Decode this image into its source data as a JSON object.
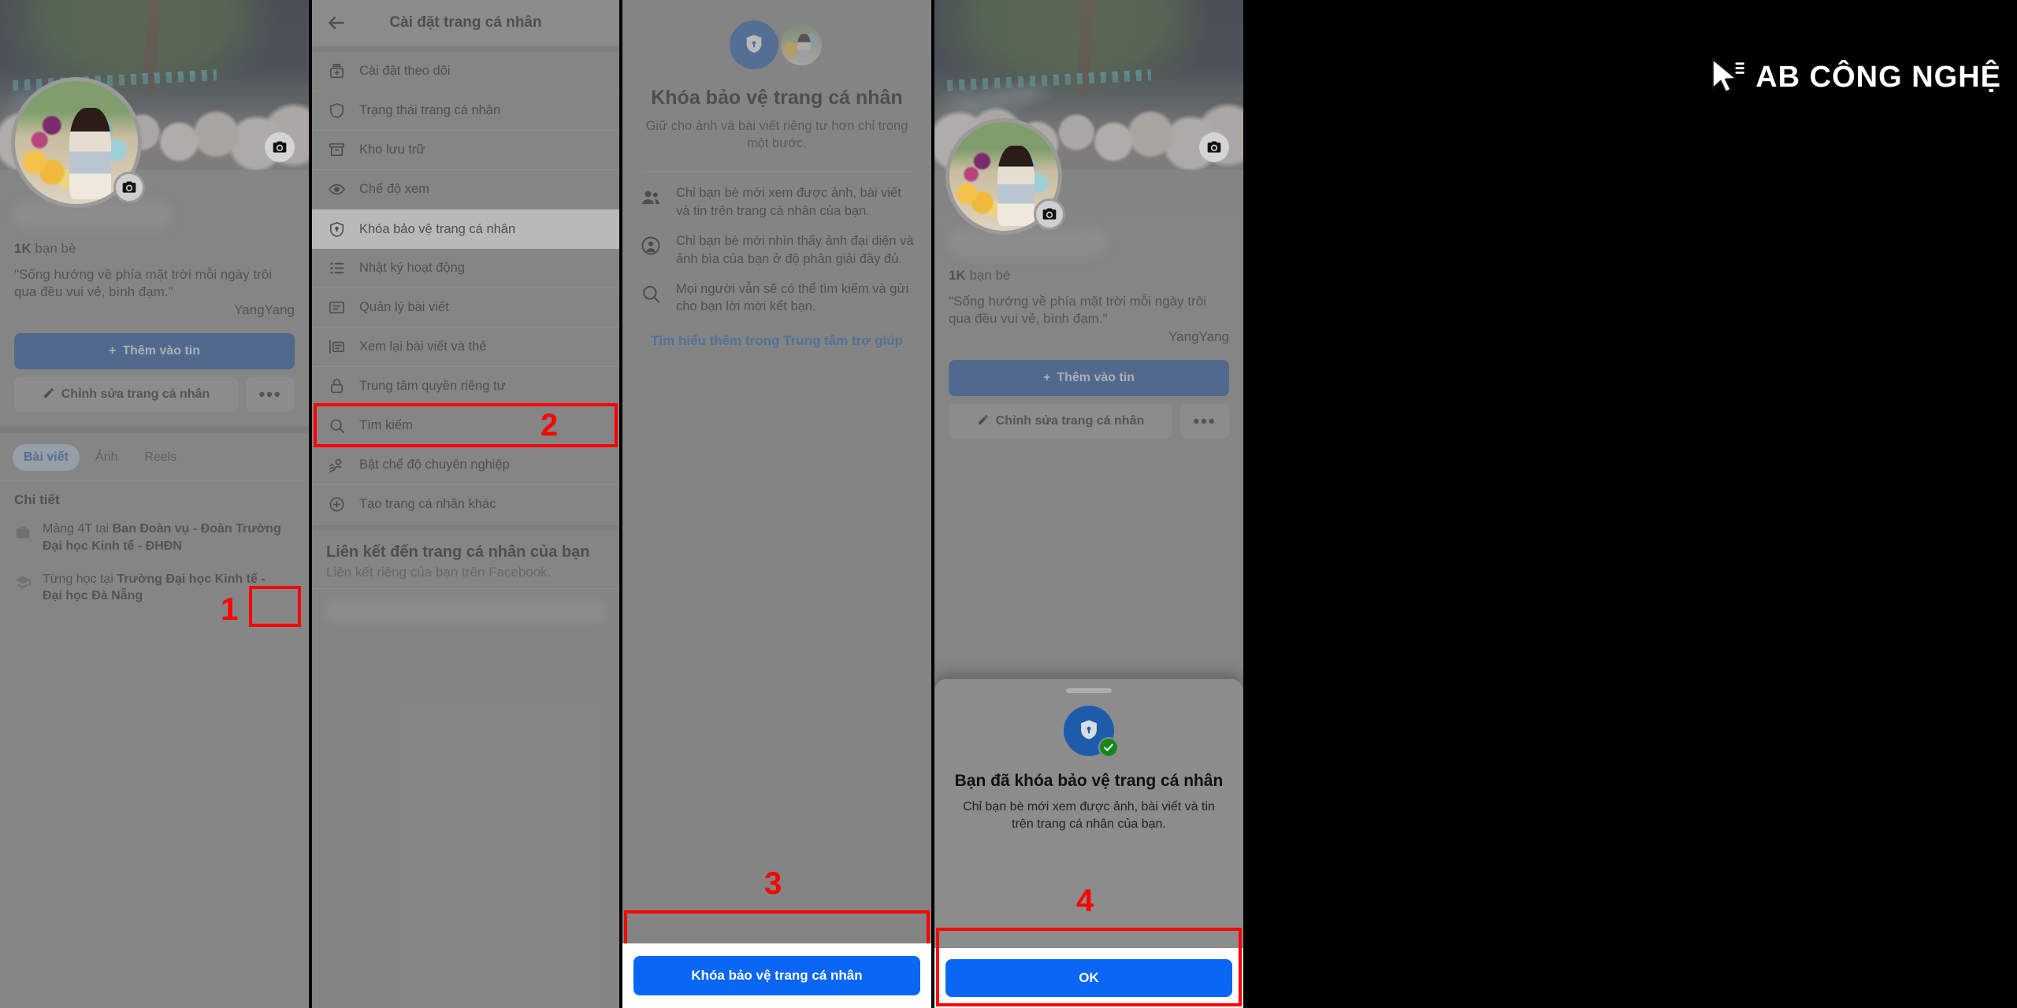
{
  "watermark": {
    "text": "AB CÔNG NGHỆ",
    "cursor_icon": "mouse-cursor-icon"
  },
  "annotations": {
    "step1": "1",
    "step2": "2",
    "step3": "3",
    "step4": "4"
  },
  "panel1": {
    "name_redacted": "",
    "friends_count": "1K",
    "friends_label": "bạn bè",
    "bio_line1": "\"Sống hướng về phía mặt trời mỗi ngày trôi",
    "bio_line2": "qua đều vui vẻ, bình đạm.\"",
    "bio_signature": "YangYang",
    "add_story_button": "Thêm vào tin",
    "add_story_icon": "plus-icon",
    "edit_profile_button": "Chỉnh sửa trang cá nhân",
    "edit_profile_icon": "pencil-icon",
    "more_button": "•••",
    "cover_camera_icon": "camera-icon",
    "avatar_camera_icon": "camera-icon",
    "tabs": [
      {
        "label": "Bài viết",
        "active": true
      },
      {
        "label": "Ảnh",
        "active": false
      },
      {
        "label": "Reels",
        "active": false
      }
    ],
    "details_title": "Chi tiết",
    "details": [
      {
        "icon": "briefcase-icon",
        "prefix": "Mảng 4T tại ",
        "bold": "Ban Đoàn vụ - Đoàn Trường",
        "bold2": "Đại học Kinh tế - ĐHĐN"
      },
      {
        "icon": "graduation-cap-icon",
        "prefix": "Từng học tại ",
        "bold": "Trường Đại học Kinh tế -",
        "bold2": "Đại học Đà Nẵng"
      }
    ]
  },
  "panel2": {
    "back_icon": "arrow-left-icon",
    "title": "Cài đặt trang cá nhân",
    "menu": [
      {
        "label": "Cài đặt theo dõi",
        "icon": "add-to-feed-icon",
        "highlighted": false
      },
      {
        "label": "Trạng thái trang cá nhân",
        "icon": "shield-icon",
        "highlighted": false
      },
      {
        "label": "Kho lưu trữ",
        "icon": "archive-box-icon",
        "highlighted": false
      },
      {
        "label": "Chế độ xem",
        "icon": "eye-icon",
        "highlighted": false
      },
      {
        "label": "Khóa bảo vệ trang cá nhân",
        "icon": "shield-lock-icon",
        "highlighted": true
      },
      {
        "label": "Nhật ký hoạt động",
        "icon": "list-icon",
        "highlighted": false
      },
      {
        "label": "Quản lý bài viết",
        "icon": "post-card-icon",
        "highlighted": false
      },
      {
        "label": "Xem lại bài viết và thẻ",
        "icon": "review-tag-icon",
        "highlighted": false
      },
      {
        "label": "Trung tâm quyền riêng tư",
        "icon": "lock-icon",
        "highlighted": false
      },
      {
        "label": "Tìm kiếm",
        "icon": "search-icon",
        "highlighted": false
      },
      {
        "label": "Bật chế độ chuyên nghiệp",
        "icon": "professional-mode-icon",
        "highlighted": false
      },
      {
        "label": "Tạo trang cá nhân khác",
        "icon": "plus-circle-icon",
        "highlighted": false
      }
    ],
    "link_section_title": "Liên kết đến trang cá nhân của bạn",
    "link_section_subtitle": "Liên kết riêng của bạn trên Facebook."
  },
  "panel3": {
    "hero_shield_icon": "shield-lock-icon",
    "hero_avatar_icon": "profile-photo-icon",
    "title": "Khóa bảo vệ trang cá nhân",
    "subtitle": "Giữ cho ảnh và bài viết riêng tư hơn chỉ trong một bước.",
    "bullets": [
      {
        "icon": "friends-icon",
        "text": "Chỉ bạn bè mới xem được ảnh, bài viết và tin trên trang cá nhân của bạn."
      },
      {
        "icon": "profile-circle-icon",
        "text": "Chỉ bạn bè mới nhìn thấy ảnh đại diện và ảnh bìa của bạn ở độ phân giải đầy đủ."
      },
      {
        "icon": "search-icon",
        "text": "Mọi người vẫn sẽ có thể tìm kiếm và gửi cho bạn lời mời kết bạn."
      }
    ],
    "help_link": "Tìm hiểu thêm trong Trung tâm trợ giúp",
    "cta_button": "Khóa bảo vệ trang cá nhân"
  },
  "panel4": {
    "friends_count": "1K",
    "friends_label": "bạn bè",
    "bio_line1": "\"Sống hướng về phía mặt trời mỗi ngày trôi",
    "bio_line2": "qua đều vui vẻ, bình đạm.\"",
    "bio_signature": "YangYang",
    "add_story_button": "Thêm vào tin",
    "edit_profile_button": "Chỉnh sửa trang cá nhân",
    "more_button": "•••",
    "sheet": {
      "icon": "shield-lock-check-icon",
      "title": "Bạn đã khóa bảo vệ trang cá nhân",
      "subtitle": "Chỉ bạn bè mới xem được ảnh, bài viết và tin trên trang cá nhân của bạn.",
      "ok_button": "OK"
    }
  },
  "colors": {
    "facebook_blue": "#0a66f5",
    "dark_blue": "#1b4fa0",
    "annotation_red": "#ff0000",
    "success_green": "#14881f",
    "link_blue": "#1463b5"
  }
}
